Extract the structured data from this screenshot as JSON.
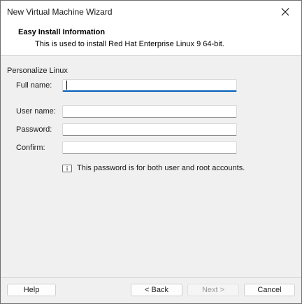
{
  "window": {
    "title": "New Virtual Machine Wizard"
  },
  "header": {
    "title": "Easy Install Information",
    "subtitle": "This is used to install Red Hat Enterprise Linux 9 64-bit."
  },
  "personalize": {
    "group_label": "Personalize Linux",
    "full_name": {
      "label": "Full name:",
      "value": ""
    },
    "user_name": {
      "label": "User name:",
      "value": ""
    },
    "password": {
      "label": "Password:",
      "value": ""
    },
    "confirm": {
      "label": "Confirm:",
      "value": ""
    },
    "info_text": "This password is for both user and root accounts."
  },
  "buttons": {
    "help": "Help",
    "back": "< Back",
    "next": "Next >",
    "cancel": "Cancel"
  },
  "colors": {
    "accent": "#005fb8",
    "window_bg": "#f0f0f0"
  },
  "icons": {
    "close": "close-icon",
    "info": "info-icon"
  }
}
